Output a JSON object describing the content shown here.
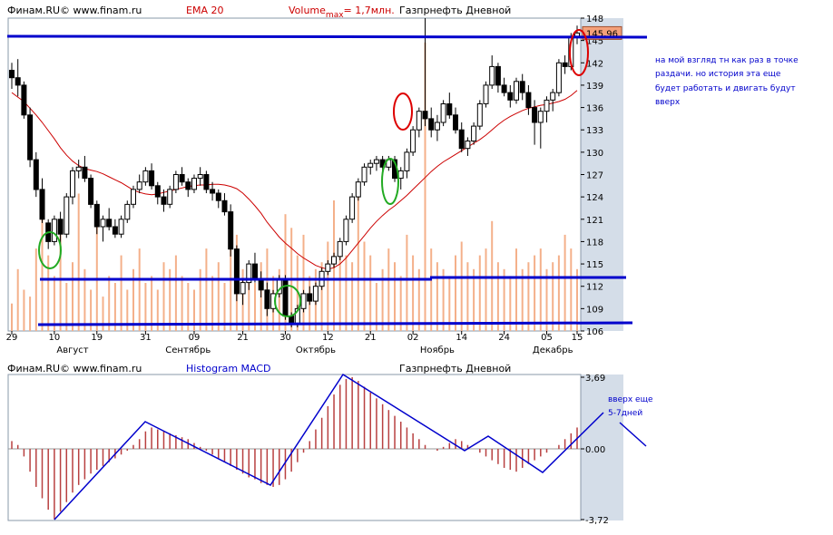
{
  "colors": {
    "frame_bg": "#d4dde8",
    "plot_bg": "#ffffff",
    "volume": "#f4b08a",
    "candle_up": "#ffffff",
    "candle_down": "#000000",
    "ema": "#cc0000",
    "macd_bar": "#b84040",
    "annotation_line": "#0000cc",
    "annotation_text": "#0000cc",
    "circle_red": "#dd0000",
    "circle_green": "#22aa22",
    "price_tag": "#f4a07a"
  },
  "top_header": {
    "source": "Финам.RU© www.finam.ru",
    "indicator": "EMA 20",
    "volume_prefix": "Volume",
    "volume_sub": "max",
    "volume_value": "= 1,7млн.",
    "title": "Газпрнефть Дневной"
  },
  "bottom_header": {
    "source": "Финам.RU© www.finam.ru",
    "indicator": "Histogram MACD",
    "title": "Газпрнефть Дневной"
  },
  "price_tag": "145,96",
  "notes": {
    "main_lines": [
      "на мой взгляд  тн как раз в точке",
      "раздачи. но история эта еще",
      "будет работать и двигать будут",
      "вверх"
    ],
    "macd_lines": [
      "вверх еще",
      "5-7дней"
    ]
  },
  "chart_data": [
    {
      "type": "candlestick",
      "title": "Газпрнефть Дневной",
      "y_ticks": [
        "148",
        "145",
        "142",
        "139",
        "136",
        "133",
        "130",
        "127",
        "124",
        "121",
        "118",
        "115",
        "112",
        "109",
        "106"
      ],
      "ylim": [
        106,
        148
      ],
      "x_day_labels": [
        "29",
        "10",
        "19",
        "31",
        "09",
        "21",
        "30",
        "12",
        "21",
        "02",
        "14",
        "24",
        "05",
        "15"
      ],
      "x_month_labels": [
        "Август",
        "Сентябрь",
        "Октябрь",
        "Ноябрь",
        "Декабрь"
      ],
      "series": [
        {
          "name": "EMA 20",
          "values": [
            138,
            137.4,
            136.8,
            135.9,
            135,
            134,
            132.9,
            131.8,
            130.6,
            129.6,
            128.8,
            128.2,
            127.8,
            127.6,
            127.4,
            127.1,
            126.7,
            126.3,
            125.9,
            125.4,
            124.9,
            124.6,
            124.4,
            124.3,
            124.4,
            124.6,
            124.8,
            125,
            125.2,
            125.4,
            125.5,
            125.6,
            125.6,
            125.7,
            125.7,
            125.6,
            125.4,
            125.1,
            124.5,
            123.7,
            122.8,
            121.8,
            120.6,
            119.6,
            118.6,
            117.8,
            117.1,
            116.4,
            115.8,
            115.3,
            114.8,
            114.5,
            114.3,
            114.5,
            115,
            115.8,
            116.8,
            117.8,
            118.8,
            119.8,
            120.7,
            121.5,
            122.2,
            122.8,
            123.5,
            124.2,
            125,
            125.8,
            126.6,
            127.4,
            128.1,
            128.7,
            129.2,
            129.7,
            130.2,
            130.7,
            131.2,
            131.7,
            132.3,
            133,
            133.7,
            134.3,
            134.8,
            135.2,
            135.6,
            135.9,
            136.1,
            136.3,
            136.4,
            136.6,
            136.8,
            137.1,
            137.6,
            138.3
          ]
        },
        {
          "name": "MACD histogram",
          "values": [
            0.4,
            0.2,
            -0.4,
            -1.2,
            -2,
            -2.6,
            -3.2,
            -3.7,
            -3.3,
            -2.8,
            -2.3,
            -1.9,
            -1.6,
            -1.3,
            -1.1,
            -0.9,
            -0.7,
            -0.5,
            -0.3,
            -0.1,
            0.2,
            0.5,
            0.9,
            1.1,
            1.0,
            0.9,
            0.8,
            0.7,
            0.6,
            0.5,
            0.3,
            0.1,
            -0.1,
            -0.3,
            -0.5,
            -0.7,
            -0.9,
            -1.1,
            -1.3,
            -1.5,
            -1.6,
            -1.8,
            -1.9,
            -2,
            -1.9,
            -1.6,
            -1.2,
            -0.7,
            -0.2,
            0.4,
            1,
            1.6,
            2.2,
            2.8,
            3.3,
            3.6,
            3.69,
            3.5,
            3.2,
            2.9,
            2.6,
            2.3,
            2,
            1.7,
            1.4,
            1.1,
            0.8,
            0.5,
            0.2,
            0,
            -0.1,
            0.1,
            0.3,
            0.5,
            0.4,
            0.2,
            0,
            -0.2,
            -0.4,
            -0.6,
            -0.8,
            -1,
            -1.1,
            -1.2,
            -1,
            -0.8,
            -0.6,
            -0.4,
            -0.2,
            0,
            0.2,
            0.5,
            0.8,
            1.1
          ]
        }
      ],
      "ohlc": [
        [
          141,
          142,
          138.5,
          140
        ],
        [
          140,
          142.5,
          137.5,
          139
        ],
        [
          139,
          139.5,
          134.5,
          135
        ],
        [
          135,
          136,
          128,
          129
        ],
        [
          129,
          130,
          124,
          125
        ],
        [
          125,
          126.5,
          120.5,
          121
        ],
        [
          120.5,
          121,
          117,
          118
        ],
        [
          118,
          121.5,
          117.5,
          121
        ],
        [
          121,
          122,
          117.5,
          119
        ],
        [
          119,
          124.5,
          118.5,
          124
        ],
        [
          124,
          128,
          123,
          127.5
        ],
        [
          127.5,
          129,
          126.5,
          128
        ],
        [
          128,
          129.5,
          126,
          126.5
        ],
        [
          126.5,
          127,
          122.5,
          123
        ],
        [
          123,
          123.5,
          119,
          120
        ],
        [
          120,
          121.5,
          118,
          121
        ],
        [
          121,
          122.5,
          119.5,
          120
        ],
        [
          120,
          121,
          118.5,
          119
        ],
        [
          119,
          121.5,
          118.5,
          121
        ],
        [
          121,
          123.5,
          120.5,
          123
        ],
        [
          123,
          125.5,
          122.5,
          125
        ],
        [
          125,
          127,
          124.5,
          126
        ],
        [
          126,
          128,
          125.5,
          127.5
        ],
        [
          127.5,
          128.5,
          125,
          125.5
        ],
        [
          125.5,
          126,
          123,
          124
        ],
        [
          124,
          125,
          122,
          123
        ],
        [
          123,
          125.5,
          122.5,
          125
        ],
        [
          125,
          127.5,
          124.5,
          127
        ],
        [
          127,
          128,
          125.5,
          126
        ],
        [
          126,
          126.5,
          124,
          125
        ],
        [
          125,
          127,
          124.5,
          126.5
        ],
        [
          126.5,
          128,
          125.5,
          127
        ],
        [
          127,
          127.5,
          124.5,
          125
        ],
        [
          125,
          126,
          123.5,
          124.5
        ],
        [
          124.5,
          125,
          122.5,
          123.5
        ],
        [
          123.5,
          124.5,
          121.5,
          122
        ],
        [
          122,
          123,
          116,
          117
        ],
        [
          117,
          117.5,
          110,
          111
        ],
        [
          111,
          113,
          109.5,
          112.5
        ],
        [
          112.5,
          115.5,
          111.5,
          115
        ],
        [
          115,
          116.5,
          112.5,
          113
        ],
        [
          113,
          114,
          110.5,
          111.5
        ],
        [
          111.5,
          112.5,
          108,
          109
        ],
        [
          109,
          111.5,
          108.5,
          111
        ],
        [
          111,
          113.5,
          110.5,
          113
        ],
        [
          113,
          113.5,
          107.5,
          108
        ],
        [
          108,
          108.5,
          106.5,
          107
        ],
        [
          107,
          109.5,
          106.5,
          109
        ],
        [
          109,
          111.5,
          108.5,
          111
        ],
        [
          111,
          112,
          109.5,
          110
        ],
        [
          110,
          112.5,
          109.5,
          112
        ],
        [
          112,
          114.5,
          111.5,
          114
        ],
        [
          114,
          115.5,
          113.5,
          115
        ],
        [
          115,
          116.5,
          114.5,
          116
        ],
        [
          116,
          118.5,
          115.5,
          118
        ],
        [
          118,
          121.5,
          117.5,
          121
        ],
        [
          121,
          124.5,
          120.5,
          124
        ],
        [
          124,
          126.5,
          123.5,
          126
        ],
        [
          126,
          128.5,
          125.5,
          128
        ],
        [
          128,
          129,
          127,
          128.5
        ],
        [
          128.5,
          129.5,
          127.5,
          129
        ],
        [
          129,
          129.5,
          127.5,
          128
        ],
        [
          128,
          129.5,
          127.5,
          129
        ],
        [
          129,
          129.5,
          126,
          126.5
        ],
        [
          126.5,
          128,
          125,
          127.5
        ],
        [
          127.5,
          130.5,
          126.5,
          130
        ],
        [
          130,
          133.5,
          129.5,
          133
        ],
        [
          133,
          136,
          132,
          135.5
        ],
        [
          135.5,
          148,
          133.5,
          134.5
        ],
        [
          134.5,
          136,
          132,
          133
        ],
        [
          133,
          135,
          131.5,
          134
        ],
        [
          134,
          137,
          133.5,
          136.5
        ],
        [
          136.5,
          138,
          134.5,
          135
        ],
        [
          135,
          136,
          132.5,
          133
        ],
        [
          133,
          134,
          130,
          130.5
        ],
        [
          130.5,
          132,
          129.5,
          131.5
        ],
        [
          131.5,
          134,
          131,
          133.5
        ],
        [
          133.5,
          137,
          133,
          136.5
        ],
        [
          136.5,
          139.5,
          136,
          139
        ],
        [
          139,
          143,
          138.5,
          141.5
        ],
        [
          141.5,
          142,
          138,
          139
        ],
        [
          139,
          140,
          137.5,
          138
        ],
        [
          138,
          139,
          136,
          137
        ],
        [
          137,
          140,
          136.5,
          139.5
        ],
        [
          139.5,
          140.5,
          137,
          138
        ],
        [
          138,
          139,
          135,
          136
        ],
        [
          136,
          137,
          131,
          134
        ],
        [
          134,
          136,
          130.5,
          135.5
        ],
        [
          135.5,
          137.5,
          134,
          137
        ],
        [
          137,
          138.5,
          135.5,
          138
        ],
        [
          138,
          142.5,
          137.5,
          142
        ],
        [
          142,
          143,
          140.5,
          141.5
        ],
        [
          141.5,
          146,
          141,
          145.5
        ],
        [
          145.5,
          147,
          144.5,
          146
        ]
      ],
      "volume": [
        20,
        45,
        30,
        25,
        60,
        90,
        55,
        40,
        70,
        35,
        50,
        100,
        45,
        30,
        85,
        25,
        40,
        35,
        55,
        30,
        45,
        60,
        35,
        40,
        30,
        50,
        45,
        55,
        40,
        35,
        30,
        45,
        60,
        40,
        50,
        35,
        80,
        70,
        45,
        40,
        35,
        50,
        60,
        40,
        45,
        85,
        75,
        55,
        70,
        40,
        45,
        50,
        65,
        95,
        60,
        55,
        50,
        100,
        65,
        55,
        35,
        45,
        60,
        50,
        40,
        70,
        55,
        45,
        210,
        60,
        50,
        45,
        40,
        55,
        65,
        50,
        45,
        55,
        60,
        80,
        50,
        45,
        40,
        60,
        45,
        50,
        55,
        60,
        45,
        50,
        55,
        70,
        60,
        45
      ]
    }
  ]
}
